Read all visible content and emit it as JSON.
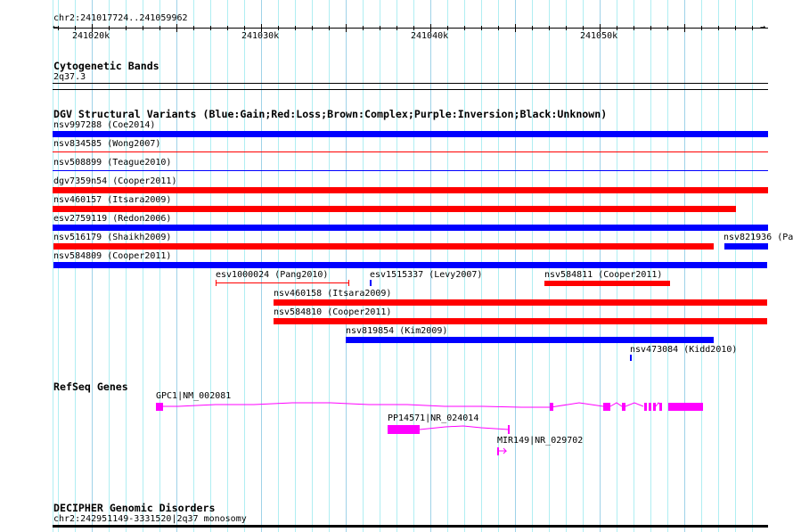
{
  "ruler": {
    "range": "chr2:241017724..241059962",
    "ticks": [
      "241020k",
      "241030k",
      "241040k",
      "241050k"
    ]
  },
  "cytoband": {
    "title": "Cytogenetic Bands",
    "band": "2q37.3"
  },
  "dgv": {
    "title": "DGV Structural Variants (Blue:Gain;Red:Loss;Brown:Complex;Purple:Inversion;Black:Unknown)",
    "colors": {
      "gain": "#0000ff",
      "loss": "#ff0000"
    },
    "variants": [
      "nsv997288 (Coe2014)",
      "nsv834585 (Wong2007)",
      "nsv508899 (Teague2010)",
      "dgv7359n54 (Cooper2011)",
      "nsv460157 (Itsara2009)",
      "esv2759119 (Redon2006)",
      "nsv516179 (Shaikh2009)",
      "nsv821936 (Pa",
      "nsv584809 (Cooper2011)",
      "esv1000024 (Pang2010)",
      "esv1515337 (Levy2007)",
      "nsv584811 (Cooper2011)",
      "nsv460158 (Itsara2009)",
      "nsv584810 (Cooper2011)",
      "nsv819854 (Kim2009)",
      "nsv473084 (Kidd2010)"
    ]
  },
  "refseq": {
    "title": "RefSeq Genes",
    "color": "#ff00ff",
    "genes": [
      "GPC1|NM_002081",
      "PP14571|NR_024014",
      "MIR149|NR_029702"
    ]
  },
  "decipher": {
    "title": "DECIPHER Genomic Disorders",
    "item": "chr2:242951149-3331520|2q37 monosomy"
  }
}
